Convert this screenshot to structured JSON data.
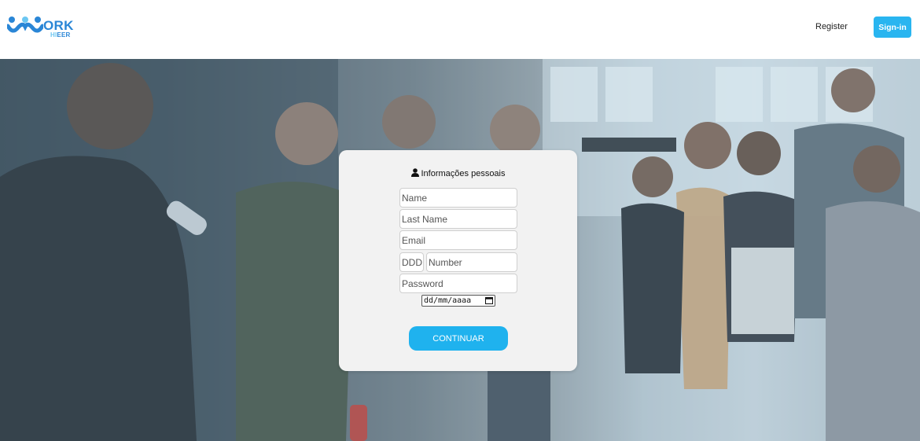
{
  "header": {
    "logo": {
      "text_main": "ORK",
      "text_sub_light": "HI",
      "text_sub_dark": "EER"
    },
    "register_label": "Register",
    "signin_label": "Sign-in"
  },
  "hero": {
    "image": "people-at-event-photo"
  },
  "form": {
    "title": "Informações pessoais",
    "icon": "user-icon",
    "fields": {
      "name_placeholder": "Name",
      "last_name_placeholder": "Last Name",
      "email_placeholder": "Email",
      "ddd_placeholder": "DDD",
      "number_placeholder": "Number",
      "password_placeholder": "Password",
      "date_placeholder": "dd/mm/aaaa"
    },
    "continue_label": "CONTINUAR"
  },
  "colors": {
    "accent": "#29b5f0",
    "logo_blue": "#2a86d6",
    "card_bg": "#f2f2f2"
  }
}
